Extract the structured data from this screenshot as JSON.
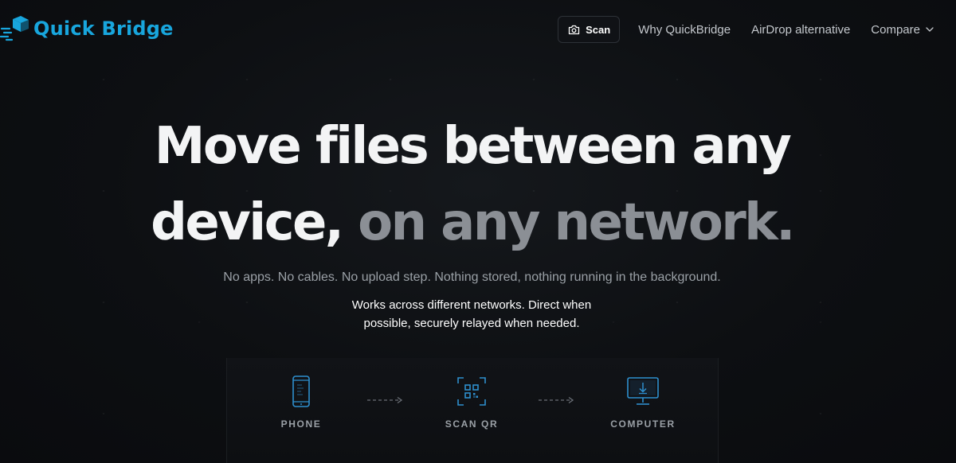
{
  "brand": {
    "name": "Quick Bridge",
    "color": "#18a6dd"
  },
  "nav": {
    "scan_label": "Scan",
    "links": [
      "Why QuickBridge",
      "AirDrop alternative",
      "Compare"
    ]
  },
  "hero": {
    "title_line1": "Move files between any",
    "title_line2_bright": "device,",
    "title_line2_muted": "on any network.",
    "subtitle": "No apps. No cables. No upload step. Nothing stored, nothing running in the background.",
    "note_line1": "Works across different networks. Direct when",
    "note_line2": "possible, securely relayed when needed."
  },
  "steps": [
    {
      "label": "PHONE",
      "icon": "phone-icon"
    },
    {
      "label": "SCAN QR",
      "icon": "qr-scan-icon"
    },
    {
      "label": "COMPUTER",
      "icon": "monitor-download-icon"
    }
  ],
  "colors": {
    "background": "#0b0d10",
    "accent": "#18a6dd",
    "muted_text": "#8b8f95"
  }
}
